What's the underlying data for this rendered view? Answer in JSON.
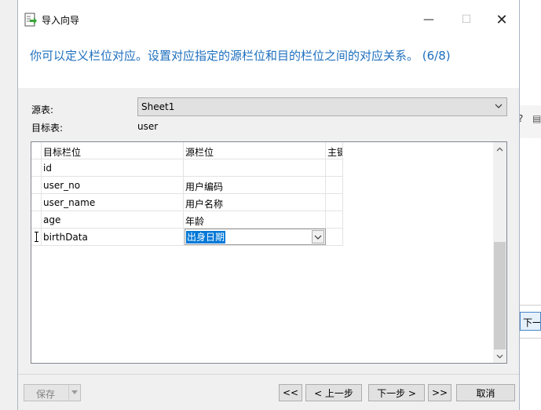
{
  "window": {
    "title": "导入向导",
    "minimize_glyph": "—",
    "maximize_glyph": "☐",
    "close_glyph": "✕"
  },
  "heading": "你可以定义栏位对应。设置对应指定的源栏位和目的栏位之间的对应关系。 (6/8)",
  "source_table": {
    "label": "源表:",
    "value": "Sheet1"
  },
  "target_table": {
    "label": "目标表:",
    "value": "user"
  },
  "grid": {
    "headers": {
      "target": "目标栏位",
      "source": "源栏位",
      "key": "主键"
    },
    "rows": [
      {
        "target": "id",
        "source": ""
      },
      {
        "target": "user_no",
        "source": "用户编码"
      },
      {
        "target": "user_name",
        "source": "用户名称"
      },
      {
        "target": "age",
        "source": "年龄"
      },
      {
        "target": "birthData",
        "source": "出身日期",
        "editing": true
      }
    ]
  },
  "buttons": {
    "save": "保存",
    "first": "<<",
    "prev": "< 上一步",
    "next": "下一步 >",
    "last": ">>",
    "cancel": "取消"
  },
  "background_window": {
    "button_label": "下一",
    "glyph": "?"
  }
}
